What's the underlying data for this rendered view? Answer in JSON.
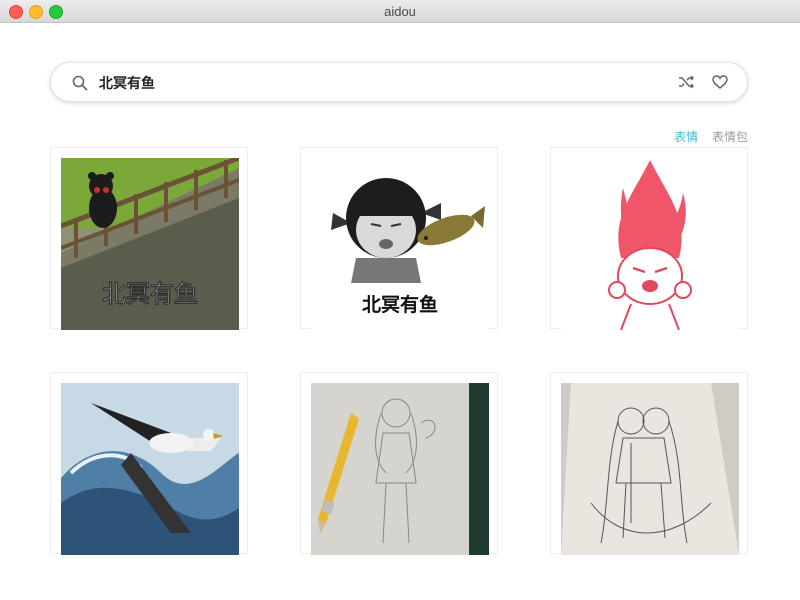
{
  "window": {
    "title": "aidou"
  },
  "search": {
    "value": "北冥有鱼"
  },
  "tabs": [
    {
      "label": "表情",
      "active": true
    },
    {
      "label": "表情包",
      "active": false
    }
  ],
  "results": [
    {
      "caption": "北冥有鱼",
      "subject": "bear on bridge meme"
    },
    {
      "caption": "北冥有鱼",
      "subject": "cartoon girl holding fish meme"
    },
    {
      "caption": "",
      "subject": "angry girl with fire hair"
    },
    {
      "caption": "",
      "subject": "eagle over waves drawing"
    },
    {
      "caption": "",
      "subject": "pencil sketch with pencil"
    },
    {
      "caption": "",
      "subject": "pencil sketch of two girls"
    }
  ],
  "colors": {
    "accent": "#3bbbd0",
    "inactive_tab": "#9a9a9a",
    "flame": "#f0566a"
  }
}
